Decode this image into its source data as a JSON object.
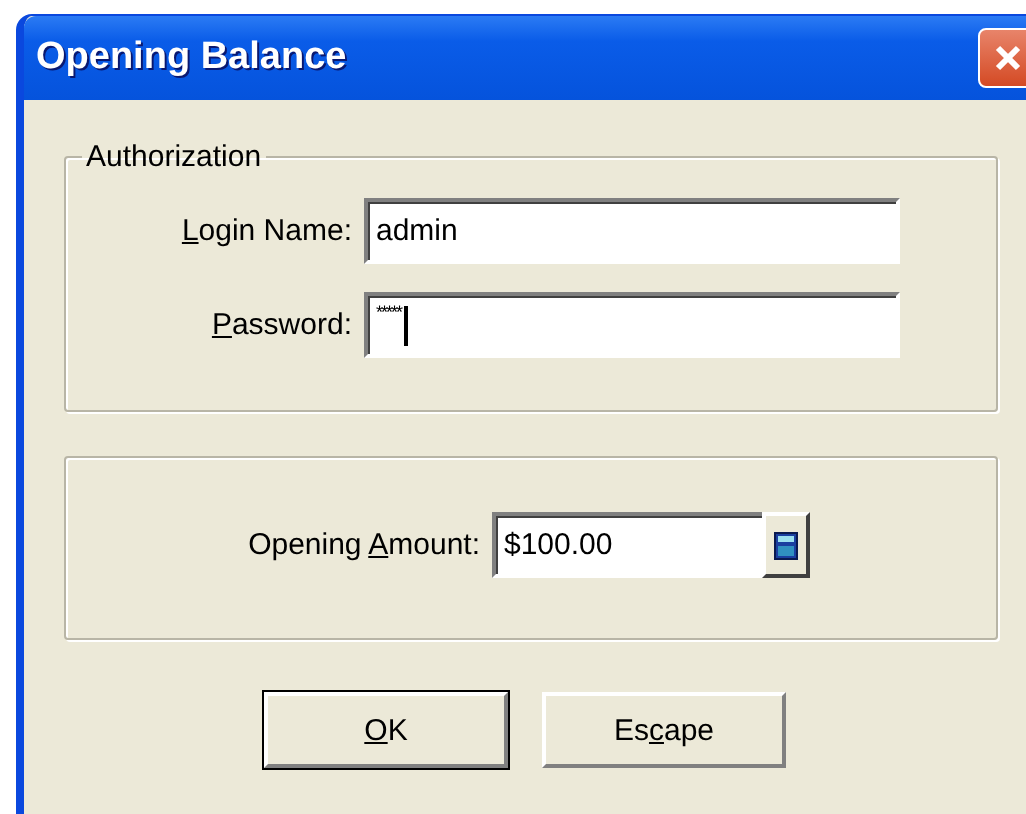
{
  "window": {
    "title": "Opening Balance"
  },
  "authorization": {
    "legend": "Authorization",
    "fields": [
      {
        "access_key": "L",
        "label_after": "ogin Name:",
        "value": "admin",
        "focused": false
      },
      {
        "access_key": "P",
        "label_after": "assword:",
        "value": "*****",
        "focused": true
      }
    ]
  },
  "amount": {
    "label_before": "Opening ",
    "access_key": "A",
    "label_after": "mount:",
    "value": "$100.00"
  },
  "buttons": [
    {
      "access_key": "O",
      "label_after": "K",
      "default": true
    },
    {
      "label_before": "Es",
      "access_key": "c",
      "label_after": "ape",
      "default": false
    }
  ]
}
